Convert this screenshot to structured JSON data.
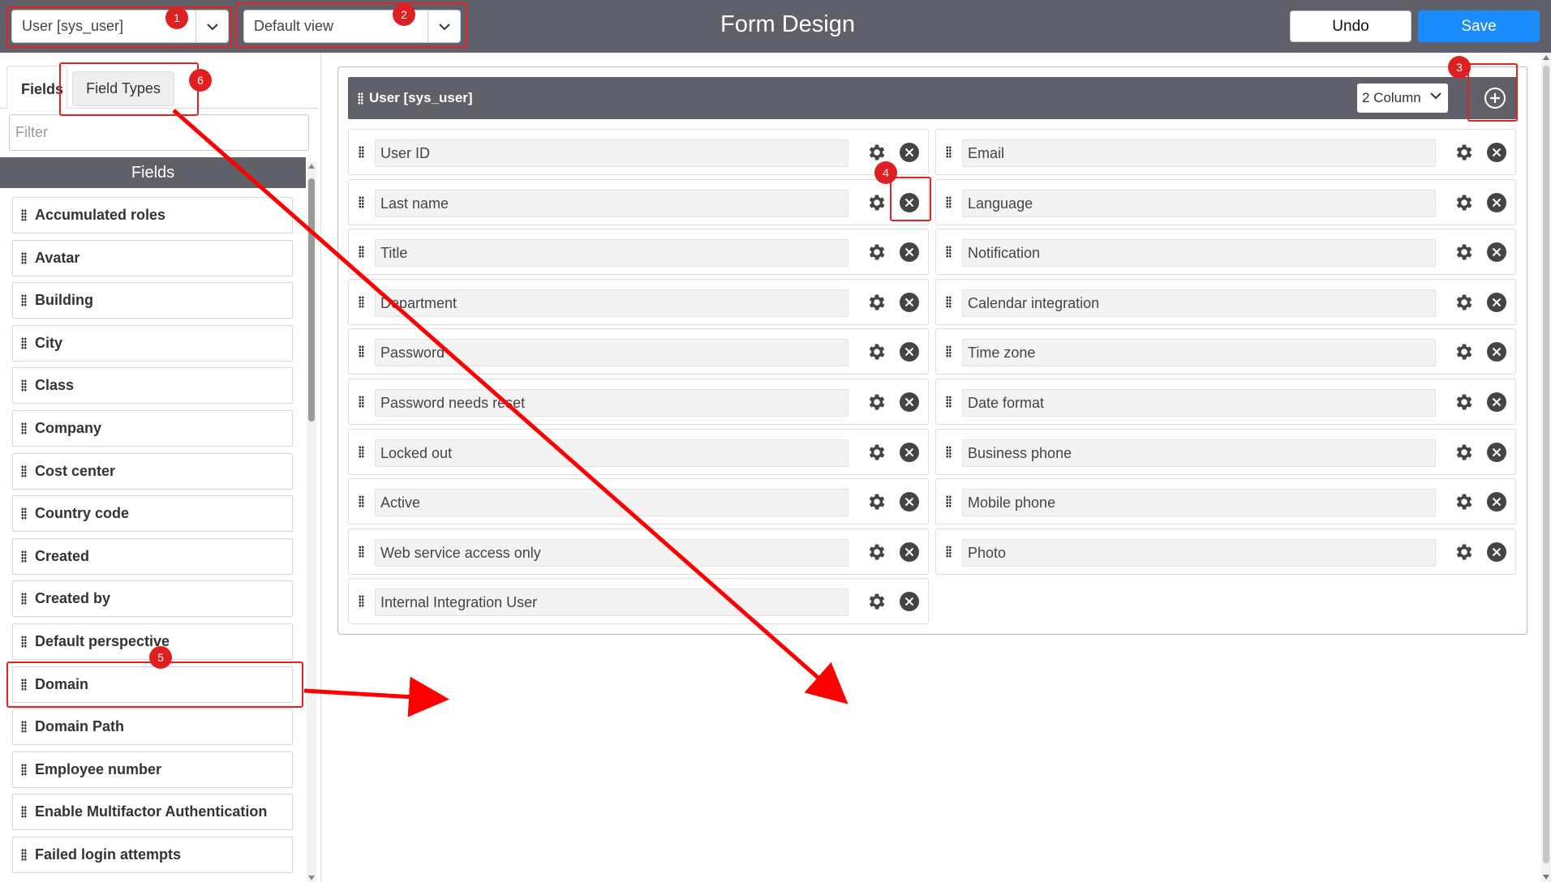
{
  "topbar": {
    "table_select": "User [sys_user]",
    "view_select": "Default view",
    "title": "Form Design",
    "undo_label": "Undo",
    "save_label": "Save"
  },
  "left_panel": {
    "tabs": [
      {
        "label": "Fields",
        "active": true
      },
      {
        "label": "Field Types",
        "active": false
      }
    ],
    "filter_placeholder": "Filter",
    "list_header": "Fields",
    "fields": [
      "Accumulated roles",
      "Avatar",
      "Building",
      "City",
      "Class",
      "Company",
      "Cost center",
      "Country code",
      "Created",
      "Created by",
      "Default perspective",
      "Domain",
      "Domain Path",
      "Employee number",
      "Enable Multifactor Authentication",
      "Failed login attempts"
    ]
  },
  "section": {
    "title": "User [sys_user]",
    "column_layout": "2 Column",
    "left_column": [
      "User ID",
      "Last name",
      "Title",
      "Department",
      "Password",
      "Password needs reset",
      "Locked out",
      "Active",
      "Web service access only",
      "Internal Integration User"
    ],
    "right_column": [
      "Email",
      "Language",
      "Notification",
      "Calendar integration",
      "Time zone",
      "Date format",
      "Business phone",
      "Mobile phone",
      "Photo"
    ]
  },
  "annotations": {
    "markers": [
      "1",
      "2",
      "3",
      "4",
      "5",
      "6"
    ],
    "color": "#e52222"
  },
  "colors": {
    "header_bg": "#5f6069",
    "save_bg": "#1a8cff"
  }
}
